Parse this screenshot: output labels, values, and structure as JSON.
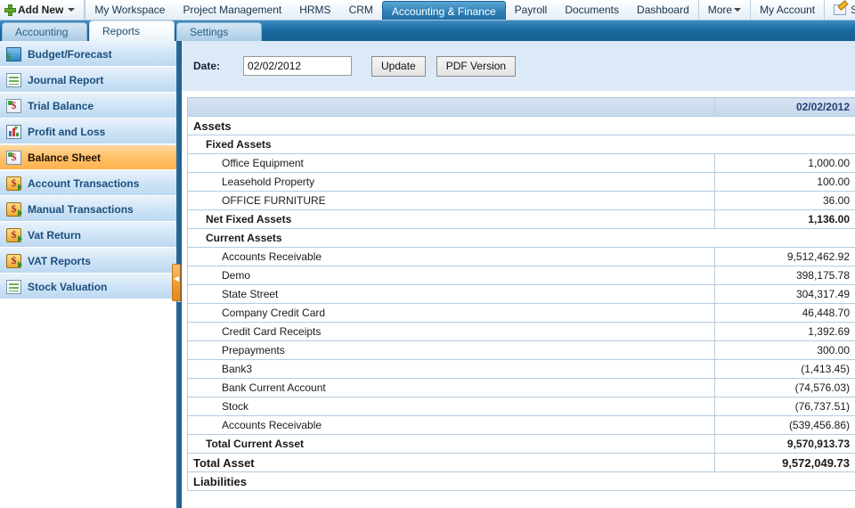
{
  "topnav": {
    "add_new": "Add New",
    "add_new_icon": "plus-icon",
    "items": [
      {
        "label": "My Workspace",
        "active": false,
        "sep": true
      },
      {
        "label": "Project Management",
        "active": false,
        "sep": false
      },
      {
        "label": "HRMS",
        "active": false,
        "sep": false
      },
      {
        "label": "CRM",
        "active": false,
        "sep": false
      },
      {
        "label": "Accounting & Finance",
        "active": true,
        "sep": false
      },
      {
        "label": "Payroll",
        "active": false,
        "sep": false
      },
      {
        "label": "Documents",
        "active": false,
        "sep": false
      },
      {
        "label": "Dashboard",
        "active": false,
        "sep": false
      },
      {
        "label": "More",
        "active": false,
        "sep": true,
        "caret": true
      },
      {
        "label": "My Account",
        "active": false,
        "sep": true
      },
      {
        "label": "Send feedba",
        "active": false,
        "sep": true,
        "icon": "feedback-pencil-icon"
      }
    ]
  },
  "tabs": [
    {
      "label": "Accounting",
      "active": false
    },
    {
      "label": "Reports",
      "active": true
    },
    {
      "label": "Settings",
      "active": false
    }
  ],
  "sidebar": {
    "items": [
      {
        "label": "Budget/Forecast",
        "icon": "budget-forecast-icon",
        "selected": false
      },
      {
        "label": "Journal Report",
        "icon": "journal-report-icon",
        "selected": false
      },
      {
        "label": "Trial Balance",
        "icon": "trial-balance-icon",
        "selected": false
      },
      {
        "label": "Profit and Loss",
        "icon": "profit-loss-chart-icon",
        "selected": false
      },
      {
        "label": "Balance Sheet",
        "icon": "balance-sheet-icon",
        "selected": true
      },
      {
        "label": "Account Transactions",
        "icon": "account-transactions-icon",
        "selected": false
      },
      {
        "label": "Manual Transactions",
        "icon": "manual-transactions-icon",
        "selected": false
      },
      {
        "label": "Vat Return",
        "icon": "vat-return-icon",
        "selected": false
      },
      {
        "label": "VAT Reports",
        "icon": "vat-reports-icon",
        "selected": false
      },
      {
        "label": "Stock Valuation",
        "icon": "stock-valuation-icon",
        "selected": false
      }
    ]
  },
  "toolbar": {
    "date_label": "Date:",
    "date_value": "02/02/2012",
    "date_placeholder": "dd/mm/yyyy",
    "update_label": "Update",
    "pdf_label": "PDF Version"
  },
  "report": {
    "column_headers": [
      "",
      "02/02/2012"
    ],
    "rows": [
      {
        "name": "Assets",
        "amount": "",
        "level": 0,
        "has_amount": false
      },
      {
        "name": "Fixed Assets",
        "amount": "",
        "level": 1,
        "has_amount": false
      },
      {
        "name": "Office Equipment",
        "amount": "1,000.00",
        "level": 2,
        "has_amount": true
      },
      {
        "name": "Leasehold Property",
        "amount": "100.00",
        "level": 2,
        "has_amount": true
      },
      {
        "name": "OFFICE FURNITURE",
        "amount": "36.00",
        "level": 2,
        "has_amount": true
      },
      {
        "name": "Net Fixed Assets",
        "amount": "1,136.00",
        "level": 1,
        "has_amount": true
      },
      {
        "name": "Current Assets",
        "amount": "",
        "level": 1,
        "has_amount": false
      },
      {
        "name": "Accounts Receivable",
        "amount": "9,512,462.92",
        "level": 2,
        "has_amount": true
      },
      {
        "name": "Demo",
        "amount": "398,175.78",
        "level": 2,
        "has_amount": true
      },
      {
        "name": "State Street",
        "amount": "304,317.49",
        "level": 2,
        "has_amount": true
      },
      {
        "name": "Company Credit Card",
        "amount": "46,448.70",
        "level": 2,
        "has_amount": true
      },
      {
        "name": "Credit Card Receipts",
        "amount": "1,392.69",
        "level": 2,
        "has_amount": true
      },
      {
        "name": "Prepayments",
        "amount": "300.00",
        "level": 2,
        "has_amount": true
      },
      {
        "name": "Bank3",
        "amount": "(1,413.45)",
        "level": 2,
        "has_amount": true
      },
      {
        "name": "Bank Current Account",
        "amount": "(74,576.03)",
        "level": 2,
        "has_amount": true
      },
      {
        "name": "Stock",
        "amount": "(76,737.51)",
        "level": 2,
        "has_amount": true
      },
      {
        "name": "Accounts Receivable",
        "amount": "(539,456.86)",
        "level": 2,
        "has_amount": true
      },
      {
        "name": "Total Current Asset",
        "amount": "9,570,913.73",
        "level": 1,
        "has_amount": true
      },
      {
        "name": "Total Asset",
        "amount": "9,572,049.73",
        "level": 0,
        "has_amount": true
      },
      {
        "name": "Liabilities",
        "amount": "",
        "level": 0,
        "has_amount": false
      }
    ]
  },
  "colors": {
    "accent_blue": "#1a6ba4",
    "selected_orange": "#ffb24d",
    "toolbar_bg": "#dce9f7",
    "table_border": "#b5cbe0",
    "header_text": "#2c3f73"
  }
}
